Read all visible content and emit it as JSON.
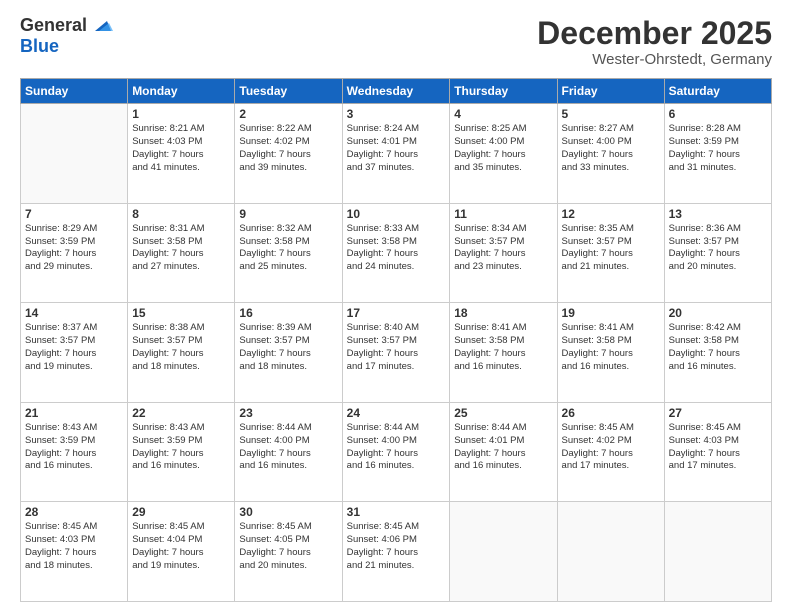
{
  "header": {
    "logo_general": "General",
    "logo_blue": "Blue",
    "month": "December 2025",
    "location": "Wester-Ohrstedt, Germany"
  },
  "weekdays": [
    "Sunday",
    "Monday",
    "Tuesday",
    "Wednesday",
    "Thursday",
    "Friday",
    "Saturday"
  ],
  "weeks": [
    [
      {
        "day": "",
        "info": ""
      },
      {
        "day": "1",
        "info": "Sunrise: 8:21 AM\nSunset: 4:03 PM\nDaylight: 7 hours\nand 41 minutes."
      },
      {
        "day": "2",
        "info": "Sunrise: 8:22 AM\nSunset: 4:02 PM\nDaylight: 7 hours\nand 39 minutes."
      },
      {
        "day": "3",
        "info": "Sunrise: 8:24 AM\nSunset: 4:01 PM\nDaylight: 7 hours\nand 37 minutes."
      },
      {
        "day": "4",
        "info": "Sunrise: 8:25 AM\nSunset: 4:00 PM\nDaylight: 7 hours\nand 35 minutes."
      },
      {
        "day": "5",
        "info": "Sunrise: 8:27 AM\nSunset: 4:00 PM\nDaylight: 7 hours\nand 33 minutes."
      },
      {
        "day": "6",
        "info": "Sunrise: 8:28 AM\nSunset: 3:59 PM\nDaylight: 7 hours\nand 31 minutes."
      }
    ],
    [
      {
        "day": "7",
        "info": "Sunrise: 8:29 AM\nSunset: 3:59 PM\nDaylight: 7 hours\nand 29 minutes."
      },
      {
        "day": "8",
        "info": "Sunrise: 8:31 AM\nSunset: 3:58 PM\nDaylight: 7 hours\nand 27 minutes."
      },
      {
        "day": "9",
        "info": "Sunrise: 8:32 AM\nSunset: 3:58 PM\nDaylight: 7 hours\nand 25 minutes."
      },
      {
        "day": "10",
        "info": "Sunrise: 8:33 AM\nSunset: 3:58 PM\nDaylight: 7 hours\nand 24 minutes."
      },
      {
        "day": "11",
        "info": "Sunrise: 8:34 AM\nSunset: 3:57 PM\nDaylight: 7 hours\nand 23 minutes."
      },
      {
        "day": "12",
        "info": "Sunrise: 8:35 AM\nSunset: 3:57 PM\nDaylight: 7 hours\nand 21 minutes."
      },
      {
        "day": "13",
        "info": "Sunrise: 8:36 AM\nSunset: 3:57 PM\nDaylight: 7 hours\nand 20 minutes."
      }
    ],
    [
      {
        "day": "14",
        "info": "Sunrise: 8:37 AM\nSunset: 3:57 PM\nDaylight: 7 hours\nand 19 minutes."
      },
      {
        "day": "15",
        "info": "Sunrise: 8:38 AM\nSunset: 3:57 PM\nDaylight: 7 hours\nand 18 minutes."
      },
      {
        "day": "16",
        "info": "Sunrise: 8:39 AM\nSunset: 3:57 PM\nDaylight: 7 hours\nand 18 minutes."
      },
      {
        "day": "17",
        "info": "Sunrise: 8:40 AM\nSunset: 3:57 PM\nDaylight: 7 hours\nand 17 minutes."
      },
      {
        "day": "18",
        "info": "Sunrise: 8:41 AM\nSunset: 3:58 PM\nDaylight: 7 hours\nand 16 minutes."
      },
      {
        "day": "19",
        "info": "Sunrise: 8:41 AM\nSunset: 3:58 PM\nDaylight: 7 hours\nand 16 minutes."
      },
      {
        "day": "20",
        "info": "Sunrise: 8:42 AM\nSunset: 3:58 PM\nDaylight: 7 hours\nand 16 minutes."
      }
    ],
    [
      {
        "day": "21",
        "info": "Sunrise: 8:43 AM\nSunset: 3:59 PM\nDaylight: 7 hours\nand 16 minutes."
      },
      {
        "day": "22",
        "info": "Sunrise: 8:43 AM\nSunset: 3:59 PM\nDaylight: 7 hours\nand 16 minutes."
      },
      {
        "day": "23",
        "info": "Sunrise: 8:44 AM\nSunset: 4:00 PM\nDaylight: 7 hours\nand 16 minutes."
      },
      {
        "day": "24",
        "info": "Sunrise: 8:44 AM\nSunset: 4:00 PM\nDaylight: 7 hours\nand 16 minutes."
      },
      {
        "day": "25",
        "info": "Sunrise: 8:44 AM\nSunset: 4:01 PM\nDaylight: 7 hours\nand 16 minutes."
      },
      {
        "day": "26",
        "info": "Sunrise: 8:45 AM\nSunset: 4:02 PM\nDaylight: 7 hours\nand 17 minutes."
      },
      {
        "day": "27",
        "info": "Sunrise: 8:45 AM\nSunset: 4:03 PM\nDaylight: 7 hours\nand 17 minutes."
      }
    ],
    [
      {
        "day": "28",
        "info": "Sunrise: 8:45 AM\nSunset: 4:03 PM\nDaylight: 7 hours\nand 18 minutes."
      },
      {
        "day": "29",
        "info": "Sunrise: 8:45 AM\nSunset: 4:04 PM\nDaylight: 7 hours\nand 19 minutes."
      },
      {
        "day": "30",
        "info": "Sunrise: 8:45 AM\nSunset: 4:05 PM\nDaylight: 7 hours\nand 20 minutes."
      },
      {
        "day": "31",
        "info": "Sunrise: 8:45 AM\nSunset: 4:06 PM\nDaylight: 7 hours\nand 21 minutes."
      },
      {
        "day": "",
        "info": ""
      },
      {
        "day": "",
        "info": ""
      },
      {
        "day": "",
        "info": ""
      }
    ]
  ]
}
